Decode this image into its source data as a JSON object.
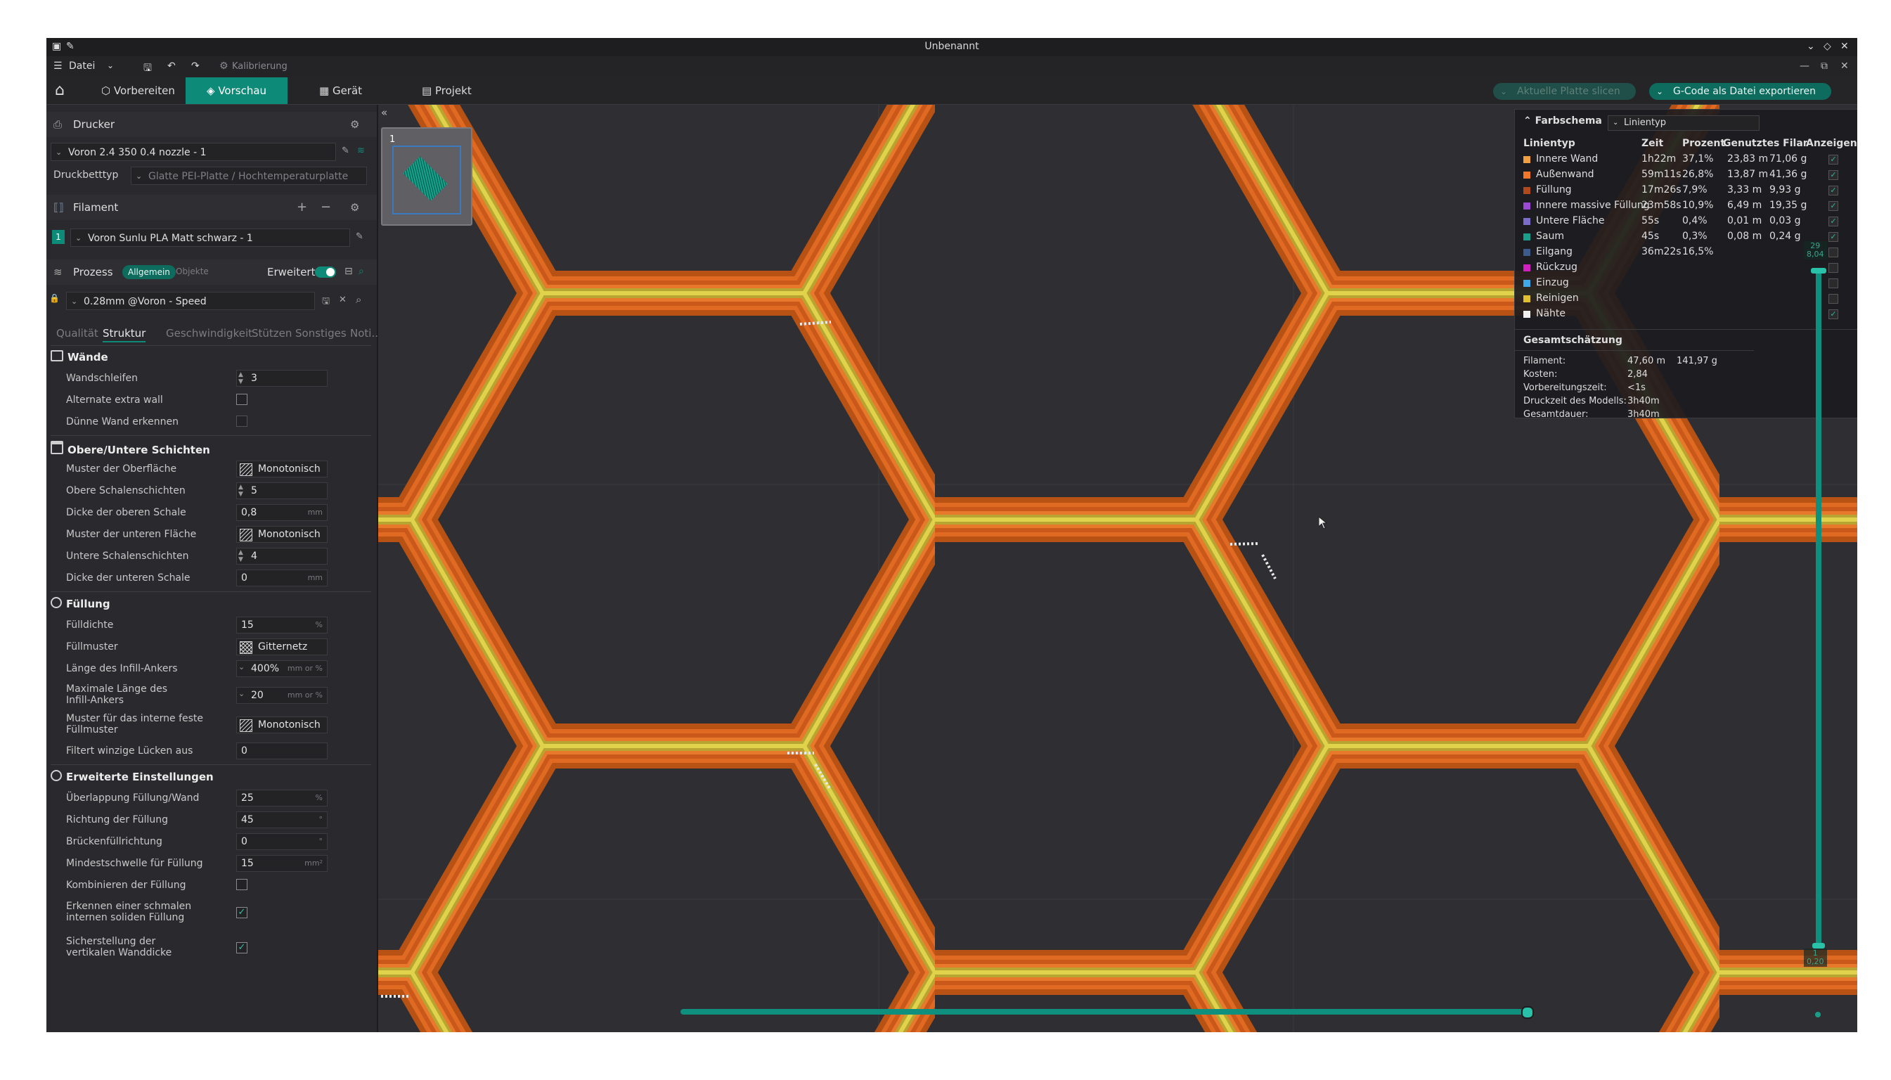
{
  "window": {
    "title": "Unbenannt"
  },
  "menu": {
    "file": "Datei",
    "calibration": "Kalibrierung"
  },
  "tabs": [
    {
      "label": "Vorbereiten"
    },
    {
      "label": "Vorschau"
    },
    {
      "label": "Gerät"
    },
    {
      "label": "Projekt"
    }
  ],
  "toolbar": {
    "slice_label": "Aktuelle Platte slicen",
    "export_label": "G-Code als Datei exportieren"
  },
  "printer": {
    "section_label": "Drucker",
    "selected": "Voron 2.4 350 0.4 nozzle - 1",
    "bed_label": "Druckbetttyp",
    "bed_value": "Glatte PEI-Platte / Hochtemperaturplatte"
  },
  "filament": {
    "section_label": "Filament",
    "index": "1",
    "selected": "Voron Sunlu PLA Matt schwarz - 1"
  },
  "process": {
    "section_label": "Prozess",
    "mode_general": "Allgemein",
    "mode_objects": "Objekte",
    "advanced_label": "Erweitert",
    "preset": "0.28mm @Voron - Speed",
    "subtabs": [
      "Qualität",
      "Struktur",
      "Geschwindigkeit",
      "Stützen",
      "Sonstiges",
      "Noti..."
    ]
  },
  "groups": {
    "walls": {
      "title": "Wände",
      "wall_loops_label": "Wandschleifen",
      "wall_loops": "3",
      "alt_wall_label": "Alternate extra wall",
      "thin_wall_label": "Dünne Wand erkennen"
    },
    "shells": {
      "title": "Obere/Untere Schichten",
      "top_pattern_label": "Muster der Oberfläche",
      "top_pattern": "Monotonisch",
      "top_layers_label": "Obere Schalenschichten",
      "top_layers": "5",
      "top_thickness_label": "Dicke der oberen Schale",
      "top_thickness": "0,8",
      "top_thickness_unit": "mm",
      "bottom_pattern_label": "Muster der unteren Fläche",
      "bottom_pattern": "Monotonisch",
      "bottom_layers_label": "Untere Schalenschichten",
      "bottom_layers": "4",
      "bottom_thickness_label": "Dicke der unteren Schale",
      "bottom_thickness": "0",
      "bottom_thickness_unit": "mm"
    },
    "infill": {
      "title": "Füllung",
      "density_label": "Fülldichte",
      "density": "15",
      "density_unit": "%",
      "pattern_label": "Füllmuster",
      "pattern": "Gitternetz",
      "anchor_label": "Länge des Infill-Ankers",
      "anchor": "400%",
      "anchor_unit": "mm or %",
      "anchor_max_label": "Maximale Länge des Infill-Ankers",
      "anchor_max": "20",
      "anchor_max_unit": "mm or %",
      "solid_pattern_label": "Muster für das interne feste Füllmuster",
      "solid_pattern": "Monotonisch",
      "gap_label": "Filtert winzige Lücken aus",
      "gap": "0"
    },
    "advanced": {
      "title": "Erweiterte Einstellungen",
      "overlap_label": "Überlappung Füllung/Wand",
      "overlap": "25",
      "overlap_unit": "%",
      "direction_label": "Richtung der Füllung",
      "direction": "45",
      "direction_unit": "°",
      "bridge_label": "Brückenfüllrichtung",
      "bridge": "0",
      "bridge_unit": "°",
      "threshold_label": "Mindestschwelle für Füllung",
      "threshold": "15",
      "threshold_unit": "mm²",
      "combine_label": "Kombinieren der Füllung",
      "narrow_label": "Erkennen einer schmalen internen soliden Füllung",
      "vertical_label": "Sicherstellung der vertikalen Wanddicke",
      "check": "✓"
    }
  },
  "plate": {
    "index": "1"
  },
  "legend": {
    "title": "Farbschema",
    "scheme": "Linientyp",
    "headers": [
      "Linientyp",
      "Zeit",
      "Prozent",
      "Genutztes Filament",
      "Anzeigen"
    ],
    "rows": [
      {
        "name": "Innere Wand",
        "color": "#f0a040",
        "time": "1h22m",
        "pct": "37,1%",
        "len": "23,83 m",
        "weight": "71,06 g",
        "shown": true
      },
      {
        "name": "Außenwand",
        "color": "#f07828",
        "time": "59m11s",
        "pct": "26,8%",
        "len": "13,87 m",
        "weight": "41,36 g",
        "shown": true
      },
      {
        "name": "Füllung",
        "color": "#b04a1c",
        "time": "17m26s",
        "pct": "7,9%",
        "len": "3,33 m",
        "weight": "9,93 g",
        "shown": true
      },
      {
        "name": "Innere massive Füllung",
        "color": "#9c4ad4",
        "time": "23m58s",
        "pct": "10,9%",
        "len": "6,49 m",
        "weight": "19,35 g",
        "shown": true
      },
      {
        "name": "Untere Fläche",
        "color": "#7a6cc8",
        "time": "55s",
        "pct": "0,4%",
        "len": "0,01 m",
        "weight": "0,03 g",
        "shown": true
      },
      {
        "name": "Saum",
        "color": "#1aa08a",
        "time": "45s",
        "pct": "0,3%",
        "len": "0,08 m",
        "weight": "0,24 g",
        "shown": true
      },
      {
        "name": "Eilgang",
        "color": "#3c5a8c",
        "time": "36m22s",
        "pct": "16,5%",
        "len": "",
        "weight": "",
        "shown": false
      },
      {
        "name": "Rückzug",
        "color": "#d020c0",
        "time": "",
        "pct": "",
        "len": "",
        "weight": "",
        "shown": false
      },
      {
        "name": "Einzug",
        "color": "#40a8e8",
        "time": "",
        "pct": "",
        "len": "",
        "weight": "",
        "shown": false
      },
      {
        "name": "Reinigen",
        "color": "#e0c030",
        "time": "",
        "pct": "",
        "len": "",
        "weight": "",
        "shown": false
      },
      {
        "name": "Nähte",
        "color": "#f0f0f0",
        "time": "",
        "pct": "",
        "len": "",
        "weight": "",
        "shown": true
      }
    ],
    "totals_title": "Gesamtschätzung",
    "totals": [
      {
        "label": "Filament:",
        "value": "47,60 m",
        "extra": "141,97 g"
      },
      {
        "label": "Kosten:",
        "value": "2,84",
        "extra": ""
      },
      {
        "label": "Vorbereitungszeit:",
        "value": "<1s",
        "extra": ""
      },
      {
        "label": "Druckzeit des Modells:",
        "value": "3h40m",
        "extra": ""
      },
      {
        "label": "Gesamtdauer:",
        "value": "3h40m",
        "extra": ""
      }
    ]
  },
  "layer_slider": {
    "top_layer": "29",
    "top_height": "8,04",
    "bottom_layer": "1",
    "bottom_height": "0,20"
  }
}
